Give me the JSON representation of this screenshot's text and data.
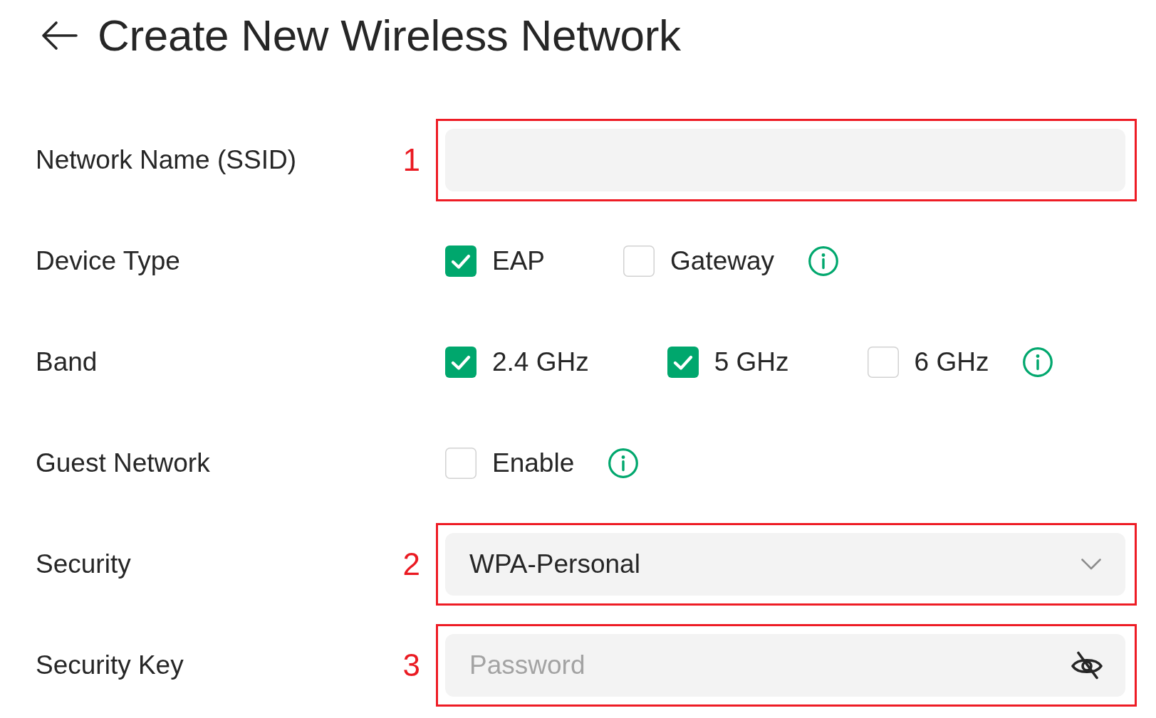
{
  "header": {
    "title": "Create New Wireless Network"
  },
  "fields": [
    {
      "kind": "text",
      "label": "Network Name (SSID)",
      "marker": "1"
    },
    {
      "kind": "checkboxes",
      "label": "Device Type",
      "info": true,
      "options": [
        {
          "label": "EAP",
          "checked": true
        },
        {
          "label": "Gateway",
          "checked": false
        }
      ]
    },
    {
      "kind": "checkboxes",
      "label": "Band",
      "info": true,
      "options": [
        {
          "label": "2.4 GHz",
          "checked": true
        },
        {
          "label": "5 GHz",
          "checked": true
        },
        {
          "label": "6 GHz",
          "checked": false
        }
      ]
    },
    {
      "kind": "checkboxes",
      "label": "Guest Network",
      "info": true,
      "options": [
        {
          "label": "Enable",
          "checked": false
        }
      ]
    },
    {
      "kind": "select",
      "label": "Security",
      "value": "WPA-Personal",
      "marker": "2"
    },
    {
      "kind": "password",
      "label": "Security Key",
      "placeholder": "Password",
      "marker": "3"
    }
  ]
}
